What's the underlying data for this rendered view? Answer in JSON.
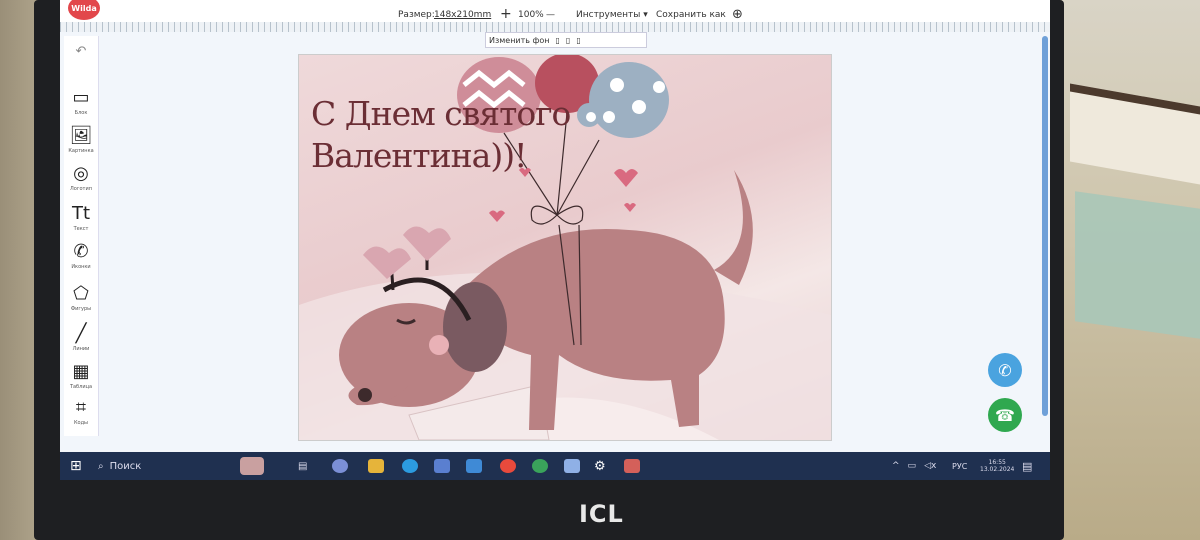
{
  "app": {
    "brand": "Wilda",
    "toolbar": {
      "size_label": "Размер:",
      "size_value": "148x210mm",
      "zoom_in": "+",
      "zoom_value": "100%",
      "zoom_out": "—",
      "tools_menu": "Инструменты ▾",
      "save_as": "Сохранить как",
      "target_icon": "crosshair-icon"
    },
    "subbar": {
      "change_bg": "Изменить фон"
    }
  },
  "tools": [
    {
      "name": "block",
      "icon": "▭",
      "label": "Блок"
    },
    {
      "name": "picture",
      "icon": "🖼",
      "label": "Картинка"
    },
    {
      "name": "logo",
      "icon": "◎",
      "label": "Логотип"
    },
    {
      "name": "text",
      "icon": "Tt",
      "label": "Текст"
    },
    {
      "name": "icons",
      "icon": "✆",
      "label": "Иконки"
    },
    {
      "name": "shapes",
      "icon": "⬠",
      "label": "Фигуры"
    },
    {
      "name": "lines",
      "icon": "╱",
      "label": "Линии"
    },
    {
      "name": "table",
      "icon": "▦",
      "label": "Таблица"
    },
    {
      "name": "qr",
      "icon": "⌗",
      "label": "Коды"
    }
  ],
  "card": {
    "line1": "С Днем святого",
    "line2": "Валентина))!"
  },
  "taskbar": {
    "search": "Поиск",
    "lang": "РУС",
    "time": "16:55",
    "date": "13.02.2024",
    "laptop_brand": "ICL"
  },
  "colors": {
    "accent_blue": "#4aa3df",
    "call_green": "#2fa84f",
    "taskbar": "#1f3050"
  }
}
